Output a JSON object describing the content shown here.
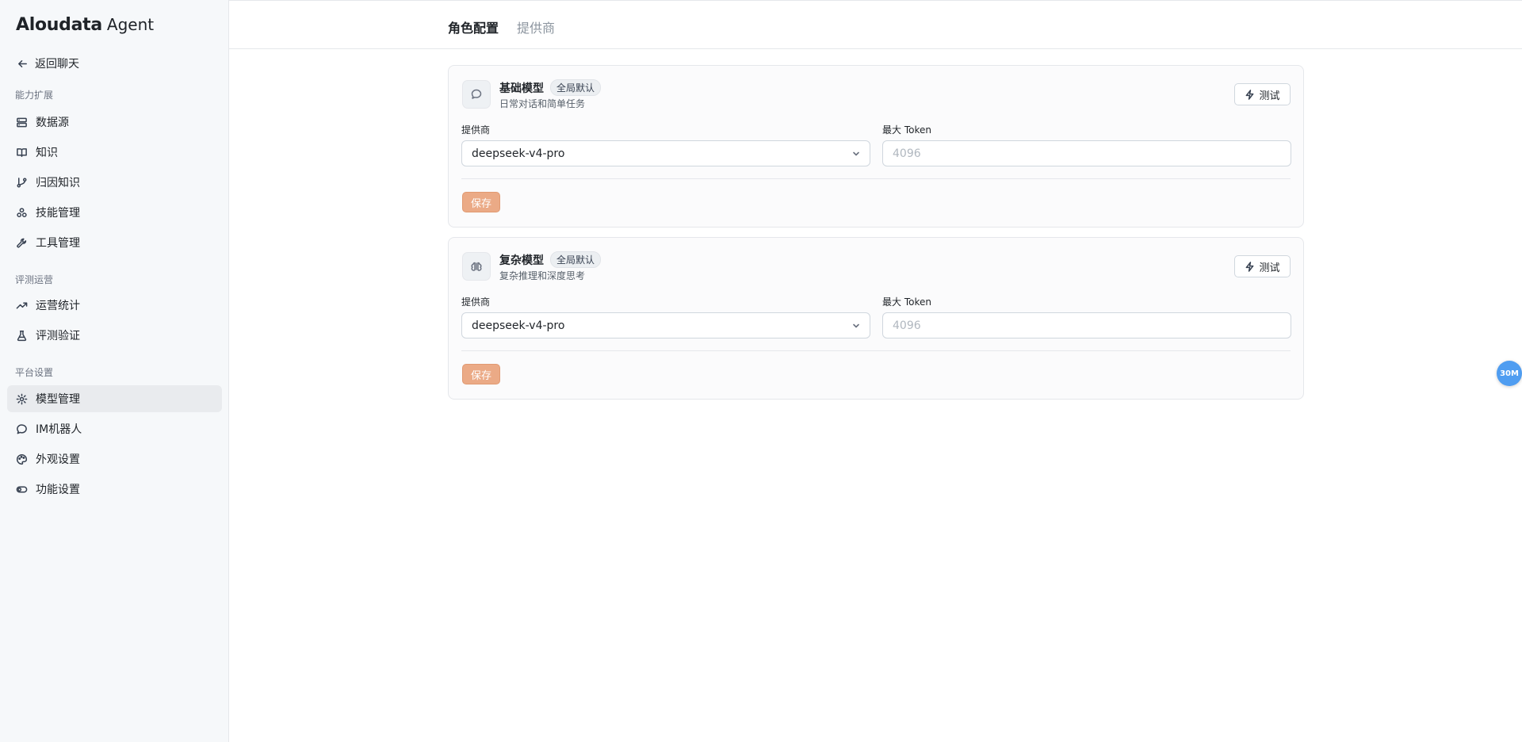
{
  "sidebar": {
    "logo_brand": "Aloudata",
    "logo_sub": "Agent",
    "back_label": "返回聊天",
    "sections": [
      {
        "label": "能力扩展",
        "items": [
          {
            "label": "数据源",
            "icon": "database-icon"
          },
          {
            "label": "知识",
            "icon": "book-icon"
          },
          {
            "label": "归因知识",
            "icon": "git-branch-icon"
          },
          {
            "label": "技能管理",
            "icon": "skills-icon"
          },
          {
            "label": "工具管理",
            "icon": "wrench-icon"
          }
        ]
      },
      {
        "label": "评测运营",
        "items": [
          {
            "label": "运营统计",
            "icon": "trending-up-icon"
          },
          {
            "label": "评测验证",
            "icon": "flask-icon"
          }
        ]
      },
      {
        "label": "平台设置",
        "items": [
          {
            "label": "模型管理",
            "icon": "gear-icon",
            "active": true
          },
          {
            "label": "IM机器人",
            "icon": "chat-bubble-icon"
          },
          {
            "label": "外观设置",
            "icon": "palette-icon"
          },
          {
            "label": "功能设置",
            "icon": "toggle-icon"
          }
        ]
      }
    ]
  },
  "tabs": [
    {
      "label": "角色配置",
      "active": true
    },
    {
      "label": "提供商",
      "active": false
    }
  ],
  "cards": [
    {
      "name": "基础模型",
      "badge": "全局默认",
      "desc": "日常对话和简单任务",
      "icon": "chat-bubble-icon",
      "test_label": "测试",
      "provider_label": "提供商",
      "provider_value": "deepseek-v4-pro",
      "token_label": "最大 Token",
      "token_placeholder": "4096",
      "save_label": "保存"
    },
    {
      "name": "复杂模型",
      "badge": "全局默认",
      "desc": "复杂推理和深度思考",
      "icon": "brain-icon",
      "test_label": "测试",
      "provider_label": "提供商",
      "provider_value": "deepseek-v4-pro",
      "token_label": "最大 Token",
      "token_placeholder": "4096",
      "save_label": "保存"
    }
  ],
  "float_badge": "30M",
  "colors": {
    "accent_save": "#ebaa86",
    "active_nav_bg": "#e9ebee",
    "float_badge": "#4f9df1"
  }
}
